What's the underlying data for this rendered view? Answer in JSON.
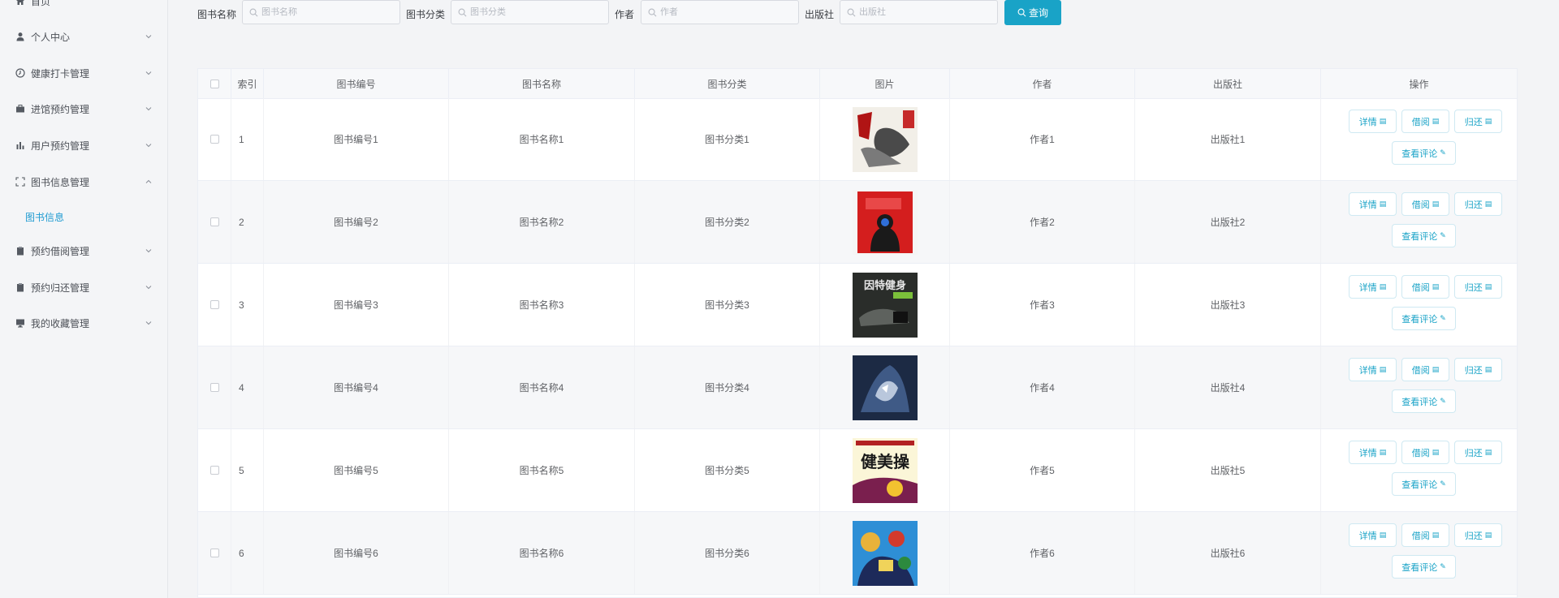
{
  "sidebar": {
    "items": [
      {
        "label": "首页",
        "icon": "home-icon"
      },
      {
        "label": "个人中心",
        "icon": "user-icon"
      },
      {
        "label": "健康打卡管理",
        "icon": "clock-icon"
      },
      {
        "label": "进馆预约管理",
        "icon": "briefcase-icon"
      },
      {
        "label": "用户预约管理",
        "icon": "bar-chart-icon"
      },
      {
        "label": "图书信息管理",
        "icon": "fullscreen-icon"
      },
      {
        "label": "预约借阅管理",
        "icon": "clipboard-icon"
      },
      {
        "label": "预约归还管理",
        "icon": "clipboard-icon"
      },
      {
        "label": "我的收藏管理",
        "icon": "monitor-icon"
      }
    ],
    "sub_item": "图书信息"
  },
  "search": {
    "fields": [
      {
        "label": "图书名称",
        "placeholder": "图书名称"
      },
      {
        "label": "图书分类",
        "placeholder": "图书分类"
      },
      {
        "label": "作者",
        "placeholder": "作者"
      },
      {
        "label": "出版社",
        "placeholder": "出版社"
      }
    ],
    "button": "查询"
  },
  "table": {
    "headers": [
      "索引",
      "图书编号",
      "图书名称",
      "图书分类",
      "图片",
      "作者",
      "出版社",
      "操作"
    ],
    "rows": [
      {
        "index": "1",
        "code": "图书编号1",
        "name": "图书名称1",
        "category": "图书分类1",
        "author": "作者1",
        "publisher": "出版社1"
      },
      {
        "index": "2",
        "code": "图书编号2",
        "name": "图书名称2",
        "category": "图书分类2",
        "author": "作者2",
        "publisher": "出版社2"
      },
      {
        "index": "3",
        "code": "图书编号3",
        "name": "图书名称3",
        "category": "图书分类3",
        "author": "作者3",
        "publisher": "出版社3"
      },
      {
        "index": "4",
        "code": "图书编号4",
        "name": "图书名称4",
        "category": "图书分类4",
        "author": "作者4",
        "publisher": "出版社4"
      },
      {
        "index": "5",
        "code": "图书编号5",
        "name": "图书名称5",
        "category": "图书分类5",
        "author": "作者5",
        "publisher": "出版社5"
      },
      {
        "index": "6",
        "code": "图书编号6",
        "name": "图书名称6",
        "category": "图书分类6",
        "author": "作者6",
        "publisher": "出版社6"
      }
    ],
    "actions": {
      "detail": "详情",
      "borrow": "借阅",
      "return": "归还",
      "comment": "查看评论"
    },
    "cover_text": {
      "row3": "因特健身",
      "row5": "健美操"
    }
  },
  "colors": {
    "accent": "#19a3c7",
    "sidebar_bg": "#f4f5f7",
    "active_text": "#1f9bd1"
  }
}
